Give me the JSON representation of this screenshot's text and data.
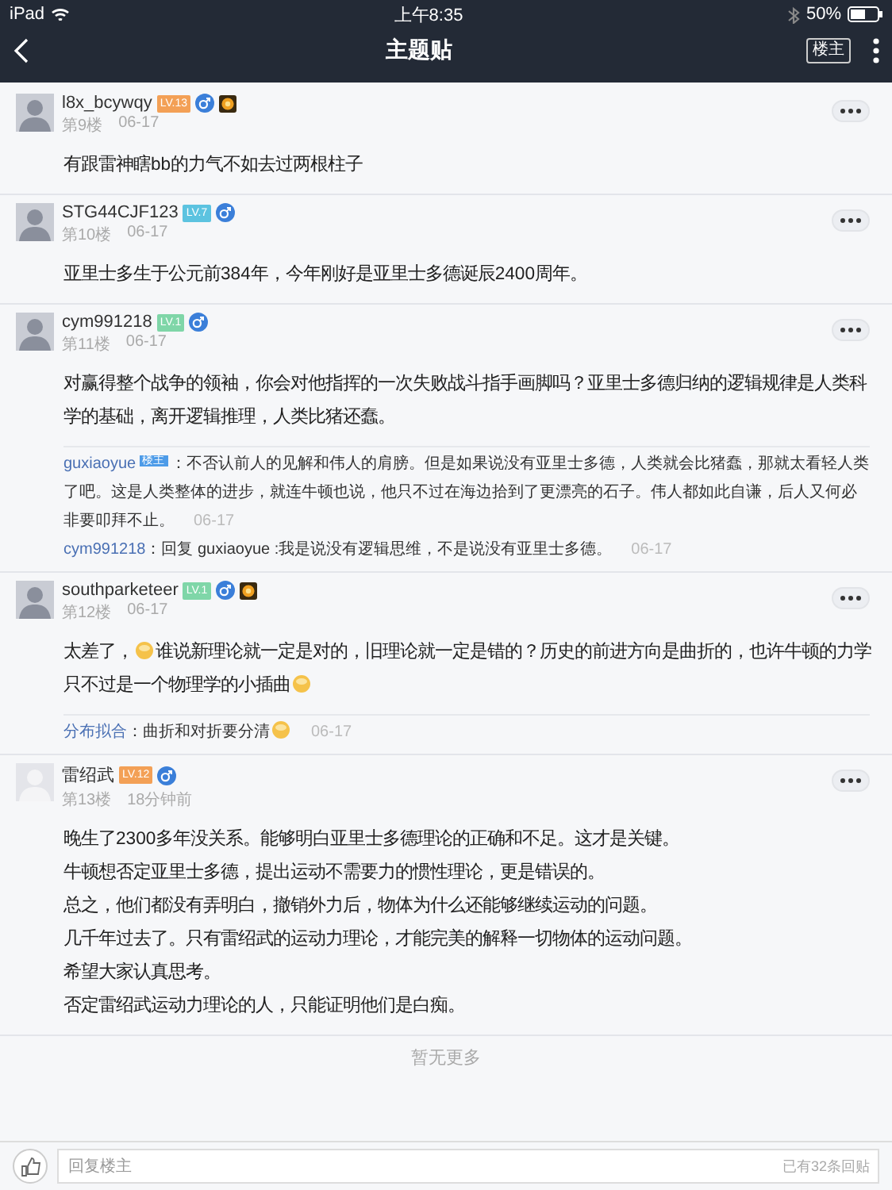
{
  "status_bar": {
    "device": "iPad",
    "time": "上午8:35",
    "battery": "50%"
  },
  "nav": {
    "title": "主题贴",
    "owner_button": "楼主"
  },
  "posts": [
    {
      "user": "l8x_bcywqy",
      "level": "LV.13",
      "color": "#f3a056",
      "medal": true,
      "floor": "第9楼",
      "time": "06-17",
      "body": [
        [
          {
            "kind": "text",
            "text": "有跟雷神瞎bb的力气不如去过两根柱子"
          }
        ]
      ]
    },
    {
      "user": "STG44CJF123",
      "level": "LV.7",
      "color": "#5cc3e0",
      "medal": false,
      "floor": "第10楼",
      "time": "06-17",
      "body": [
        [
          {
            "kind": "text",
            "text": "亚里士多生于公元前384年，今年刚好是亚里士多德诞辰2400周年。"
          }
        ]
      ]
    },
    {
      "user": "cym991218",
      "level": "LV.1",
      "color": "#7fd6a8",
      "medal": false,
      "floor": "第11楼",
      "time": "06-17",
      "body": [
        [
          {
            "kind": "text",
            "text": "对赢得整个战争的领袖，你会对他指挥的一次失败战斗指手画脚吗？亚里士多德归纳的逻辑规律是人类科学的基础，离开逻辑推理，人类比猪还蠢。"
          }
        ]
      ],
      "replies": [
        {
          "author": "guxiaoyue",
          "badge": "楼主",
          "content": [
            {
              "kind": "text",
              "text": "：不否认前人的见解和伟人的肩膀。但是如果说没有亚里士多德，人类就会比猪蠢，那就太看轻人类了吧。这是人类整体的进步，就连牛顿也说，他只不过在海边拾到了更漂亮的石子。伟人都如此自谦，后人又何必非要叩拜不止。"
            }
          ],
          "time": "06-17"
        },
        {
          "author": "cym991218",
          "content": [
            {
              "kind": "text",
              "text": "：回复 guxiaoyue :我是说没有逻辑思维，不是说没有亚里士多德。"
            }
          ],
          "time": "06-17"
        }
      ]
    },
    {
      "user": "southparketeer",
      "level": "LV.1",
      "color": "#7fd6a8",
      "medal": true,
      "floor": "第12楼",
      "time": "06-17",
      "body": [
        [
          {
            "kind": "text",
            "text": "太差了，"
          },
          {
            "kind": "emoji"
          },
          {
            "kind": "text",
            "text": "谁说新理论就一定是对的，旧理论就一定是错的？历史的前进方向是曲折的，也许牛顿的力学只不过是一个物理学的小插曲"
          },
          {
            "kind": "emoji"
          }
        ]
      ],
      "replies": [
        {
          "author": "分布拟合",
          "content": [
            {
              "kind": "text",
              "text": "：曲折和对折要分清"
            },
            {
              "kind": "emoji"
            }
          ],
          "time": "06-17"
        }
      ]
    },
    {
      "user": "雷绍武",
      "level": "LV.12",
      "color": "#f3a056",
      "medal": false,
      "floor": "第13楼",
      "time": "18分钟前",
      "body": [
        [
          {
            "kind": "text",
            "text": "晚生了2300多年没关系。能够明白亚里士多德理论的正确和不足。这才是关键。"
          }
        ],
        [
          {
            "kind": "text",
            "text": "牛顿想否定亚里士多德，提出运动不需要力的惯性理论，更是错误的。"
          }
        ],
        [
          {
            "kind": "text",
            "text": "总之，他们都没有弄明白，撤销外力后，物体为什么还能够继续运动的问题。"
          }
        ],
        [
          {
            "kind": "text",
            "text": "几千年过去了。只有雷绍武的运动力理论，才能完美的解释一切物体的运动问题。"
          }
        ],
        [
          {
            "kind": "text",
            "text": "希望大家认真思考。"
          }
        ],
        [
          {
            "kind": "text",
            "text": "否定雷绍武运动力理论的人，只能证明他们是白痴。"
          }
        ]
      ]
    }
  ],
  "end_note": "暂无更多",
  "footer": {
    "placeholder": "回复楼主",
    "count": "已有32条回贴"
  }
}
